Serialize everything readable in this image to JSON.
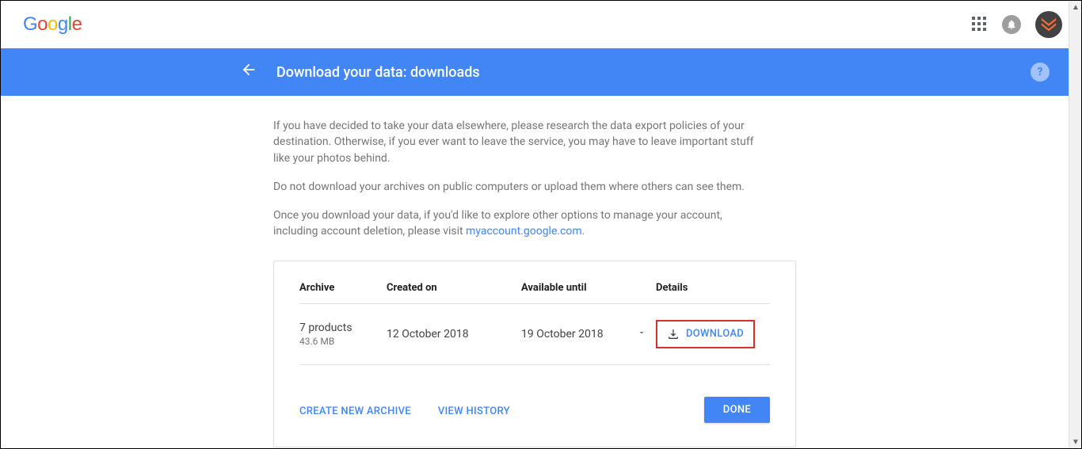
{
  "topbar": {
    "logo_text": "Google"
  },
  "header": {
    "title": "Download your data: downloads"
  },
  "intro": {
    "p1": "If you have decided to take your data elsewhere, please research the data export policies of your destination. Otherwise, if you ever want to leave the service, you may have to leave important stuff like your photos behind.",
    "p2": "Do not download your archives on public computers or upload them where others can see them.",
    "p3a": "Once you download your data, if you'd like to explore other options to manage your account, including account deletion, please visit ",
    "p3_link": "myaccount.google.com",
    "p3b": "."
  },
  "table": {
    "headers": {
      "archive": "Archive",
      "created": "Created on",
      "available": "Available until",
      "details": "Details"
    },
    "row": {
      "products": "7 products",
      "size": "43.6 MB",
      "created": "12 October 2018",
      "available": "19 October 2018",
      "download_label": "DOWNLOAD"
    }
  },
  "actions": {
    "create_new": "CREATE NEW ARCHIVE",
    "view_history": "VIEW HISTORY",
    "done": "DONE"
  }
}
